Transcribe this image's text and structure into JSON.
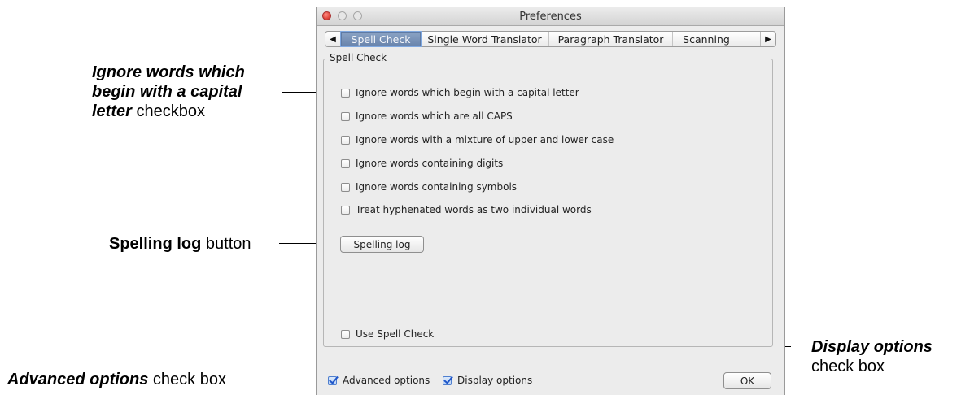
{
  "window": {
    "title": "Preferences"
  },
  "tabs": {
    "items": [
      {
        "label": "Spell Check",
        "active": true
      },
      {
        "label": "Single Word Translator",
        "active": false
      },
      {
        "label": "Paragraph Translator",
        "active": false
      },
      {
        "label": "Scanning",
        "active": false
      }
    ],
    "left_arrow": "◀",
    "right_arrow": "▶"
  },
  "spell_check": {
    "group_label": "Spell Check",
    "options": [
      {
        "label": "Ignore words which begin with a capital letter",
        "checked": false
      },
      {
        "label": "Ignore words which are all CAPS",
        "checked": false
      },
      {
        "label": "Ignore words with a mixture of upper and lower case",
        "checked": false
      },
      {
        "label": "Ignore words containing digits",
        "checked": false
      },
      {
        "label": "Ignore words containing symbols",
        "checked": false
      },
      {
        "label": "Treat hyphenated words as two individual words",
        "checked": false
      }
    ],
    "spelling_log_button": "Spelling log",
    "use_spell_check": {
      "label": "Use Spell Check",
      "checked": false
    }
  },
  "footer": {
    "advanced_options": {
      "label": "Advanced options",
      "checked": true
    },
    "display_options": {
      "label": "Display options",
      "checked": true
    },
    "ok_button": "OK"
  },
  "annotations": {
    "ignore_capital": {
      "line1": "Ignore words which",
      "line2": "begin with a capital",
      "line3_bold": "letter",
      "line3_rest": " checkbox"
    },
    "spelling_log": {
      "bold": "Spelling log",
      "rest": " button"
    },
    "advanced": {
      "bold": "Advanced options",
      "rest": " check box"
    },
    "display": {
      "bold": "Display options",
      "rest": "check box"
    }
  },
  "colors": {
    "accent_blue": "#1f56c9",
    "window_bg": "#ececec",
    "close_red": "#e0443a"
  }
}
